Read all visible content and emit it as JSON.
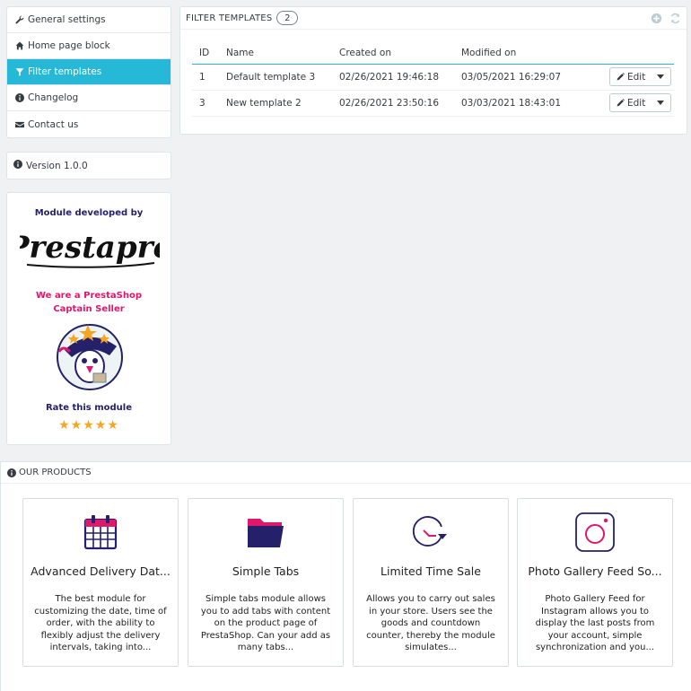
{
  "sidebar": {
    "items": [
      {
        "label": "General settings",
        "icon": "wrench-icon"
      },
      {
        "label": "Home page block",
        "icon": "home-icon"
      },
      {
        "label": "Filter templates",
        "icon": "filter-icon"
      },
      {
        "label": "Changelog",
        "icon": "info-icon"
      },
      {
        "label": "Contact us",
        "icon": "envelope-icon"
      }
    ],
    "active_index": 2,
    "version": "Version 1.0.0",
    "developer": {
      "title": "Module developed by",
      "logo_text": "Prestapro",
      "captain": "We are a PrestaShop Captain Seller",
      "rate": "Rate this module",
      "stars": "★★★★★"
    }
  },
  "filter_templates": {
    "title": "Filter templates",
    "count": "2",
    "columns": [
      "ID",
      "Name",
      "Created on",
      "Modified on"
    ],
    "rows": [
      {
        "id": "1",
        "name": "Default template 3",
        "created": "02/26/2021 19:46:18",
        "modified": "03/05/2021 16:29:07"
      },
      {
        "id": "3",
        "name": "New template 2",
        "created": "02/26/2021 23:50:16",
        "modified": "03/03/2021 18:43:01"
      }
    ],
    "edit_label": "Edit"
  },
  "products": {
    "title": "Our products",
    "items": [
      {
        "name": "Advanced Delivery Dat...",
        "desc": "The best module for customizing the date, time of order, with the ability to flexibly adjust the delivery intervals, taking into...",
        "icon": "calendar-icon"
      },
      {
        "name": "Simple Tabs",
        "desc": "Simple tabs module allows you to add tabs with content on the product page of PrestaShop. Can your add as many tabs...",
        "icon": "folder-icon"
      },
      {
        "name": "Limited Time Sale",
        "desc": "Allows you to carry out sales in your store. Users see the goods and countdown counter, thereby the module simulates...",
        "icon": "clock-icon"
      },
      {
        "name": "Photo Gallery Feed So...",
        "desc": "Photo Gallery Feed for Instagram allows you to display the last posts from your account, simple synchronization and you...",
        "icon": "instagram-icon"
      }
    ]
  },
  "colors": {
    "accent": "#25b9d7",
    "brand_pink": "#e0176a",
    "brand_navy": "#25206a",
    "star": "#f5a623"
  }
}
